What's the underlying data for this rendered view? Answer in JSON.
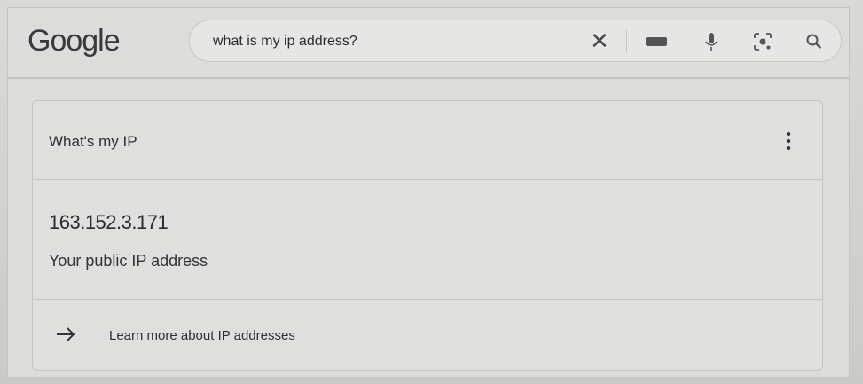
{
  "header": {
    "logo_text": "Google",
    "search": {
      "query": "what is my ip address?"
    },
    "icons": {
      "clear": "close-icon",
      "keyboard": "keyboard-icon",
      "voice": "microphone-icon",
      "lens": "camera-lens-icon",
      "search": "search-icon"
    }
  },
  "ip_card": {
    "title": "What's my IP",
    "ip_address": "163.152.3.171",
    "description": "Your public IP address",
    "learn_more": "Learn more about IP addresses"
  }
}
